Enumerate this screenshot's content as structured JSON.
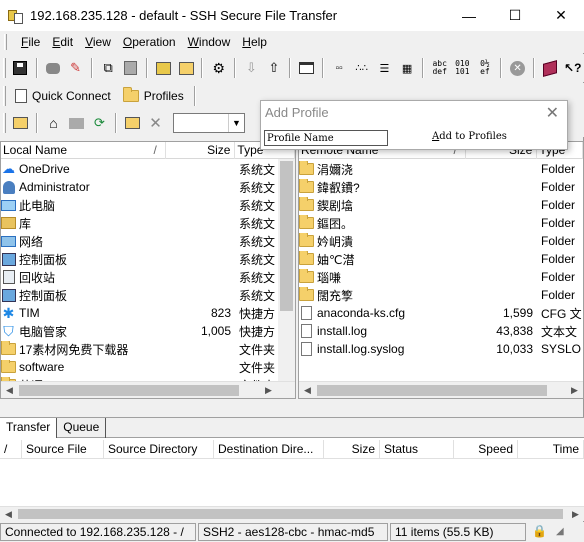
{
  "window": {
    "title": "192.168.235.128 - default - SSH Secure File Transfer",
    "minimize": "—",
    "maximize": "☐",
    "close": "✕"
  },
  "menu": {
    "items": [
      {
        "key": "F",
        "rest": "ile"
      },
      {
        "key": "E",
        "rest": "dit"
      },
      {
        "key": "V",
        "rest": "iew"
      },
      {
        "key": "O",
        "rest": "peration"
      },
      {
        "key": "W",
        "rest": "indow"
      },
      {
        "key": "H",
        "rest": "elp"
      }
    ]
  },
  "toolbar": {
    "text_buttons": [
      "abc def",
      "010 101",
      "0½ ef"
    ]
  },
  "quickbar": {
    "quick_connect": "Quick Connect",
    "profiles": "Profiles"
  },
  "dialog": {
    "title": "Add Profile",
    "close": "✕",
    "name_value": "Profile Name",
    "add_key": "A",
    "add_rest": "dd to Profiles"
  },
  "left_pane": {
    "columns": {
      "name": "Local Name",
      "sort": "/",
      "size": "Size",
      "type": "Type"
    },
    "rows": [
      {
        "icon": "onedrive-icon",
        "name": "OneDrive",
        "size": "",
        "type": "系统文"
      },
      {
        "icon": "user-icon",
        "name": "Administrator",
        "size": "",
        "type": "系统文"
      },
      {
        "icon": "computer-icon",
        "name": "此电脑",
        "size": "",
        "type": "系统文"
      },
      {
        "icon": "library-icon",
        "name": "库",
        "size": "",
        "type": "系统文"
      },
      {
        "icon": "network-icon",
        "name": "网络",
        "size": "",
        "type": "系统文"
      },
      {
        "icon": "control-panel-icon",
        "name": "控制面板",
        "size": "",
        "type": "系统文"
      },
      {
        "icon": "recycle-bin-icon",
        "name": "回收站",
        "size": "",
        "type": "系统文"
      },
      {
        "icon": "control-panel-icon",
        "name": "控制面板",
        "size": "",
        "type": "系统文"
      },
      {
        "icon": "tim-icon",
        "name": "TIM",
        "size": "823",
        "type": "快捷方"
      },
      {
        "icon": "shield-icon",
        "name": "电脑管家",
        "size": "1,005",
        "type": "快捷方"
      },
      {
        "icon": "folder-icon",
        "name": "17素材网免费下载器",
        "size": "",
        "type": "文件夹"
      },
      {
        "icon": "folder-icon",
        "name": "software",
        "size": "",
        "type": "文件夹"
      },
      {
        "icon": "folder-icon",
        "name": "英语",
        "size": "",
        "type": "文件夹"
      }
    ]
  },
  "right_pane": {
    "columns": {
      "name": "Remote Name",
      "sort": "/",
      "size": "Size",
      "type": "Type"
    },
    "rows": [
      {
        "icon": "folder-icon",
        "name": "涓嬭浇",
        "size": "",
        "type": "Folder"
      },
      {
        "icon": "folder-icon",
        "name": "鍏叡鐨?",
        "size": "",
        "type": "Folder"
      },
      {
        "icon": "folder-icon",
        "name": "鍥剧墖",
        "size": "",
        "type": "Folder"
      },
      {
        "icon": "folder-icon",
        "name": "鏂囨。",
        "size": "",
        "type": "Folder"
      },
      {
        "icon": "folder-icon",
        "name": "妗岄潰",
        "size": "",
        "type": "Folder"
      },
      {
        "icon": "folder-icon",
        "name": "妯℃澘",
        "size": "",
        "type": "Folder"
      },
      {
        "icon": "folder-icon",
        "name": "瑙嗛",
        "size": "",
        "type": "Folder"
      },
      {
        "icon": "folder-icon",
        "name": "闊充箰",
        "size": "",
        "type": "Folder"
      },
      {
        "icon": "file-icon",
        "name": "anaconda-ks.cfg",
        "size": "1,599",
        "type": "CFG 文"
      },
      {
        "icon": "file-icon",
        "name": "install.log",
        "size": "43,838",
        "type": "文本文"
      },
      {
        "icon": "file-icon",
        "name": "install.log.syslog",
        "size": "10,033",
        "type": "SYSLO"
      }
    ]
  },
  "transfer": {
    "tabs": [
      "Transfer",
      "Queue"
    ],
    "columns": [
      "/",
      "Source File",
      "Source Directory",
      "Destination Dire...",
      "Size",
      "Status",
      "Speed",
      "Time"
    ]
  },
  "status": {
    "connection": "Connected to 192.168.235.128 - /",
    "cipher": "SSH2 - aes128-cbc - hmac-md5",
    "items": "11 items (55.5 KB)"
  }
}
